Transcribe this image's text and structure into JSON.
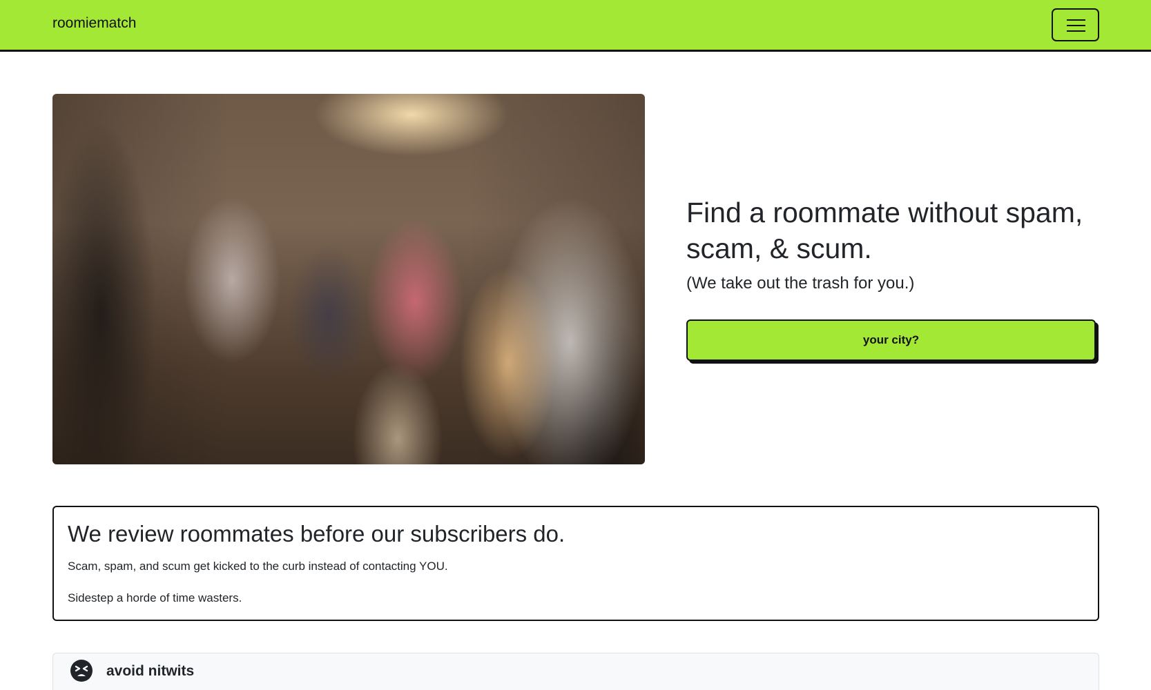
{
  "navbar": {
    "brand": "roomiematch",
    "toggle_icon": "hamburger-menu-icon",
    "accent_color": "#a4e836"
  },
  "hero": {
    "image_alt": "blurred crowd of people walking on a city street at sunset",
    "headline": "Find a roommate without spam, scam, & scum.",
    "subhead": "(We take out the trash for you.)",
    "city_button_label": "your city?"
  },
  "review": {
    "title": "We review roommates before our subscribers do.",
    "line_1": "Scam, spam, and scum get kicked to the curb instead of contacting YOU.",
    "line_2": "Sidestep a horde of time wasters."
  },
  "features": [
    {
      "icon": "grimacing-face-icon",
      "title": "avoid nitwits"
    }
  ]
}
